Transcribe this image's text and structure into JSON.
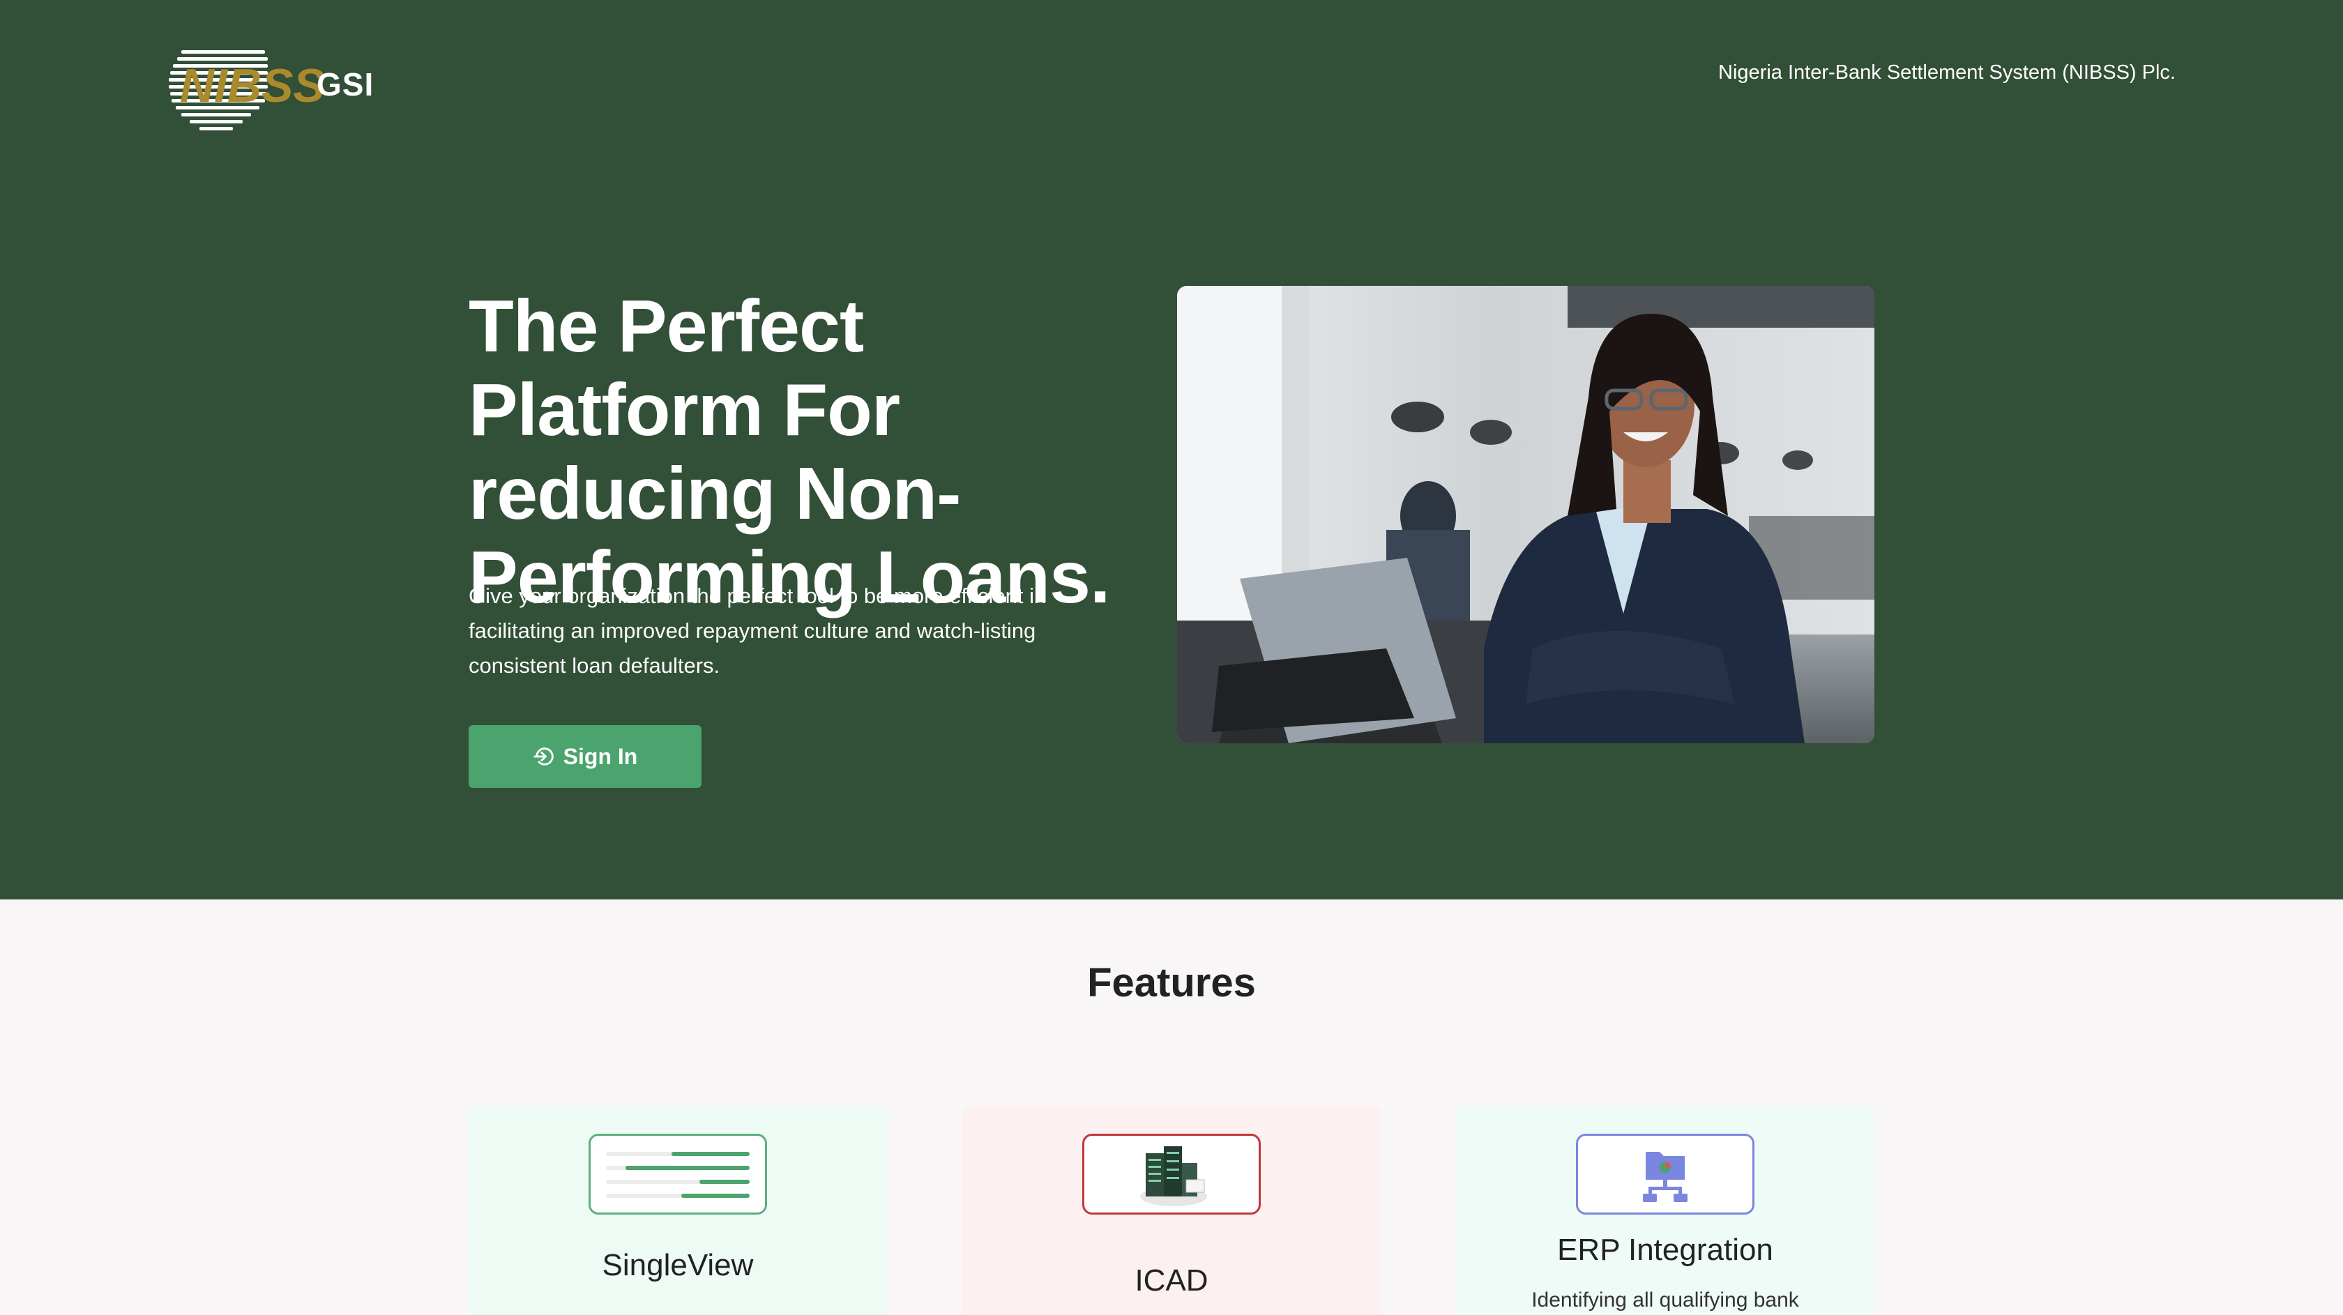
{
  "header": {
    "logo_text": "NIBSS",
    "logo_suffix": "GSI",
    "org_name": "Nigeria Inter-Bank Settlement System (NIBSS) Plc."
  },
  "hero": {
    "headline": "The Perfect Platform For reducing Non-Performing Loans.",
    "description": "Give your organization the perfect tool to be more efficient in facilitating an improved repayment culture and watch-listing consistent loan defaulters.",
    "signin_label": "Sign In",
    "signin_icon": "sign-in-icon",
    "photo_subject": "professional-woman-office-photo"
  },
  "features": {
    "title": "Features",
    "cards": [
      {
        "title": "SingleView",
        "icon": "list-bars-icon",
        "description": ""
      },
      {
        "title": "ICAD",
        "icon": "server-cluster-icon",
        "description": ""
      },
      {
        "title": "ERP Integration",
        "icon": "network-folder-icon",
        "description": "Identifying all qualifying bank"
      }
    ]
  },
  "colors": {
    "hero_bg": "#324f37",
    "accent": "#4ba36e",
    "page_bg": "#f8f6f7"
  }
}
